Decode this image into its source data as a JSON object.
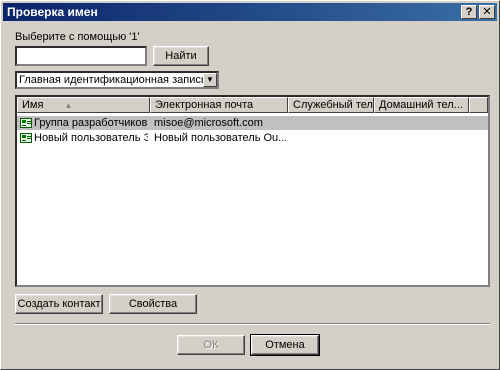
{
  "window": {
    "title": "Проверка имен",
    "help_label": "?",
    "close_label": "✕"
  },
  "search": {
    "label": "Выберите с помощью '1'",
    "value": "",
    "find_button": "Найти"
  },
  "address_book": {
    "selected": "Главная идентификационная запись ко",
    "arrow": "▼"
  },
  "contacts_table": {
    "columns": [
      "Имя",
      "Электронная почта",
      "Служебный тел...",
      "Домашний тел..."
    ],
    "sort_indicator": "▲",
    "rows": [
      {
        "icon": "contact-card-icon",
        "name": "Группа разработчиков ...",
        "email": "misoe@microsoft.com",
        "work_phone": "",
        "home_phone": "",
        "selected": true
      },
      {
        "icon": "contact-card-icon",
        "name": "Новый пользователь Э...",
        "email": "Новый пользователь Ou...",
        "work_phone": "",
        "home_phone": "",
        "selected": false
      }
    ]
  },
  "actions": {
    "create_contact": "Создать контакт",
    "properties": "Свойства"
  },
  "footer": {
    "ok": "ОК",
    "cancel": "Отмена"
  }
}
